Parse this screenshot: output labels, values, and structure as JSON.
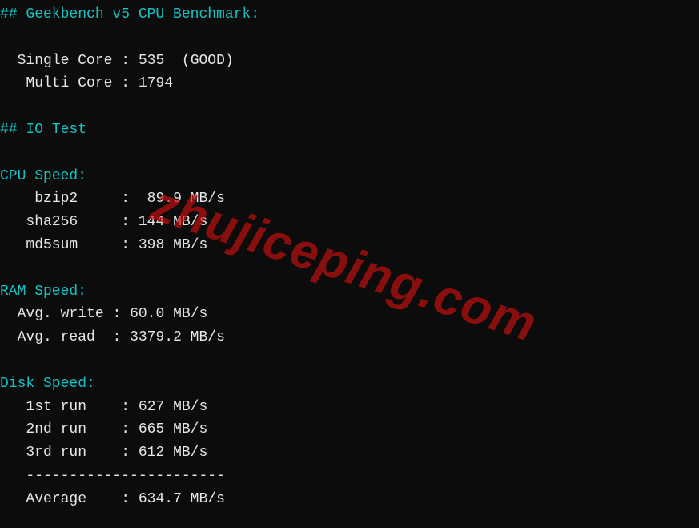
{
  "headers": {
    "geekbench": "## Geekbench v5 CPU Benchmark:",
    "iotest": "## IO Test"
  },
  "geekbench": {
    "single_label": "Single Core",
    "single_value": "535",
    "single_rating": "(GOOD)",
    "multi_label": "Multi Core",
    "multi_value": "1794"
  },
  "cpu": {
    "title": "CPU Speed:",
    "bzip2_label": "bzip2",
    "bzip2_value": "89.9 MB/s",
    "sha256_label": "sha256",
    "sha256_value": "144 MB/s",
    "md5sum_label": "md5sum",
    "md5sum_value": "398 MB/s"
  },
  "ram": {
    "title": "RAM Speed:",
    "write_label": "Avg. write",
    "write_value": "60.0 MB/s",
    "read_label": "Avg. read",
    "read_value": "3379.2 MB/s"
  },
  "disk": {
    "title": "Disk Speed:",
    "r1_label": "1st run",
    "r1_value": "627 MB/s",
    "r2_label": "2nd run",
    "r2_value": "665 MB/s",
    "r3_label": "3rd run",
    "r3_value": "612 MB/s",
    "divider": "-----------------------",
    "avg_label": "Average",
    "avg_value": "634.7 MB/s"
  },
  "watermark": "zhujiceping.com"
}
